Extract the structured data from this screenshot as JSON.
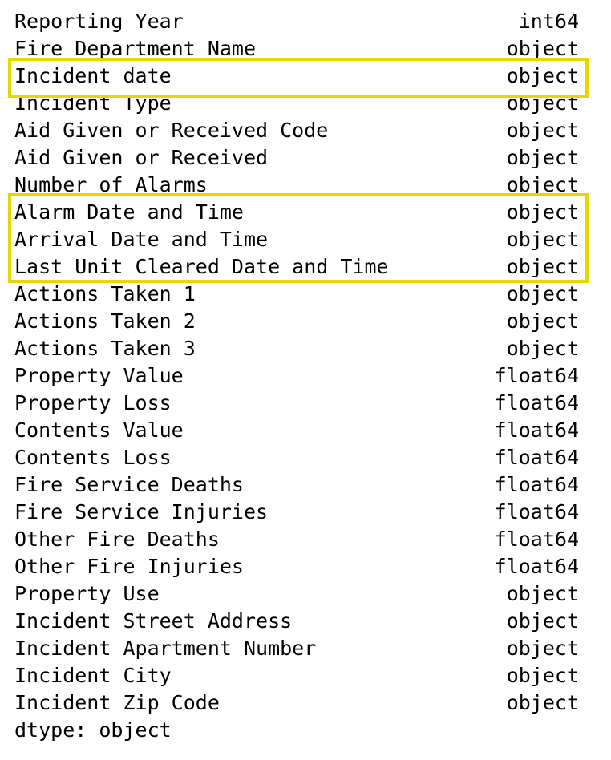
{
  "rows": [
    {
      "name": "Reporting Year",
      "dtype": "int64"
    },
    {
      "name": "Fire Department Name",
      "dtype": "object"
    },
    {
      "name": "Incident date",
      "dtype": "object"
    },
    {
      "name": "Incident Type",
      "dtype": "object"
    },
    {
      "name": "Aid Given or Received Code",
      "dtype": "object"
    },
    {
      "name": "Aid Given or Received",
      "dtype": "object"
    },
    {
      "name": "Number of Alarms",
      "dtype": "object"
    },
    {
      "name": "Alarm Date and Time",
      "dtype": "object"
    },
    {
      "name": "Arrival Date and Time",
      "dtype": "object"
    },
    {
      "name": "Last Unit Cleared Date and Time",
      "dtype": "object"
    },
    {
      "name": "Actions Taken 1",
      "dtype": "object"
    },
    {
      "name": "Actions Taken 2",
      "dtype": "object"
    },
    {
      "name": "Actions Taken 3",
      "dtype": "object"
    },
    {
      "name": "Property Value",
      "dtype": "float64"
    },
    {
      "name": "Property Loss",
      "dtype": "float64"
    },
    {
      "name": "Contents Value",
      "dtype": "float64"
    },
    {
      "name": "Contents Loss",
      "dtype": "float64"
    },
    {
      "name": "Fire Service Deaths",
      "dtype": "float64"
    },
    {
      "name": "Fire Service Injuries",
      "dtype": "float64"
    },
    {
      "name": "Other Fire Deaths",
      "dtype": "float64"
    },
    {
      "name": "Other Fire Injuries",
      "dtype": "float64"
    },
    {
      "name": "Property Use",
      "dtype": "object"
    },
    {
      "name": "Incident Street Address",
      "dtype": "object"
    },
    {
      "name": "Incident Apartment Number",
      "dtype": "object"
    },
    {
      "name": "Incident City",
      "dtype": "object"
    },
    {
      "name": "Incident Zip Code",
      "dtype": "object"
    }
  ],
  "footer": "dtype: object",
  "highlight_color": "#e8d600",
  "text_color": "#000000",
  "background_color": "#ffffff"
}
